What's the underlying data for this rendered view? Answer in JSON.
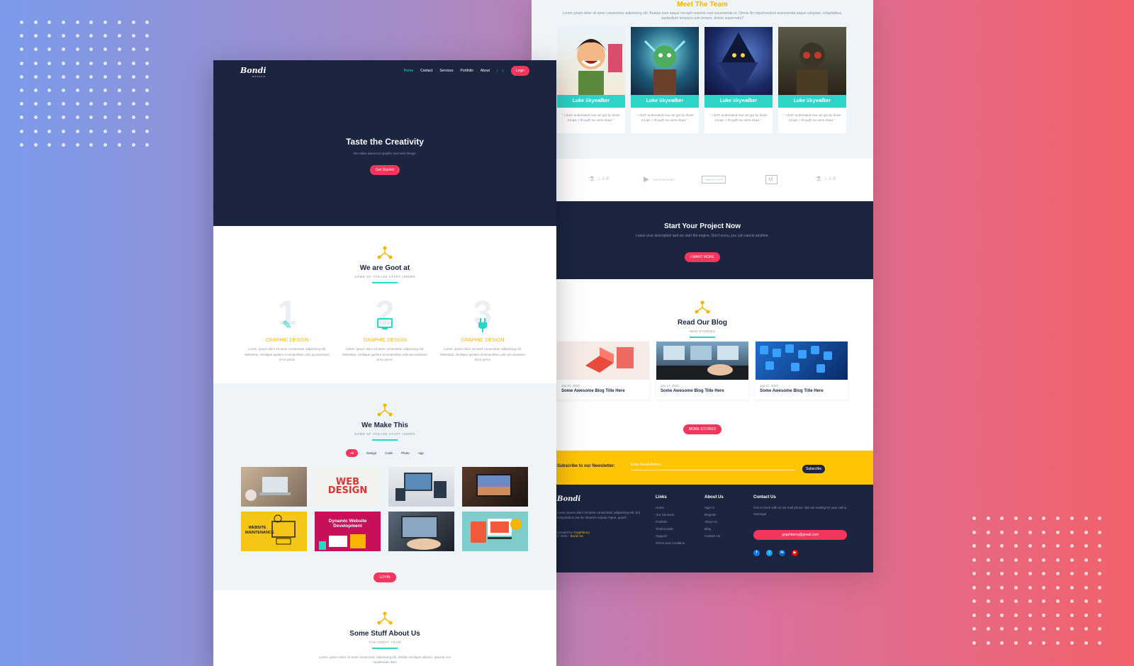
{
  "colors": {
    "navy": "#1b2540",
    "teal": "#2dd4c8",
    "red": "#f5365c",
    "yellow": "#ffc505",
    "gold": "#f7b500",
    "light": "#eef4f8"
  },
  "nav": {
    "logo": "Bondi",
    "logo_tag": "DESIGN",
    "items": [
      "Home",
      "Contact",
      "Services",
      "Portfolio",
      "About"
    ],
    "active": "Home",
    "login": "Login",
    "search_icon": "search-icon"
  },
  "hero": {
    "title": "Taste the Creativity",
    "subtitle": "We make awesome graphic and web design.",
    "cta": "Get Started"
  },
  "good": {
    "title": "We are Goot at",
    "subtitle": "SOME OF THEASE STUFF UNDER",
    "features": [
      {
        "num": "1",
        "icon": "pencil-icon",
        "title": "GRAPHIC DESIGN",
        "text": "Lorem, ipsum dolor sit amet consectetur adipisicing elit. Molestias, similique quidem et temporibus odio accusantium error porro!"
      },
      {
        "num": "2",
        "icon": "monitor-icon",
        "title": "GRAPHIC DESIGN",
        "text": "Lorem, ipsum dolor sit amet consectetur adipisicing elit. Molestias, similique quidem et temporibus odio accusantium error porro!"
      },
      {
        "num": "3",
        "icon": "plug-icon",
        "title": "GRAPHIC DESIGN",
        "text": "Lorem, ipsum dolor sit amet consectetur adipisicing elit. Molestias, similique quidem et temporibus odio accusantium error porro!"
      }
    ]
  },
  "make": {
    "title": "We Make This",
    "subtitle": "SOME OF THEASE STUFF UNDER",
    "filters": [
      "All",
      "Design",
      "Code",
      "Photo",
      "App"
    ],
    "active_filter": "All",
    "more": "LOVIN",
    "items": [
      "",
      "WEB DESIGN",
      "",
      "",
      "WEBSITE MAINTENANCE",
      "Dynamic Website Development",
      "",
      ""
    ]
  },
  "about": {
    "title": "Some Stuff About Us",
    "subtitle": "THE GREAT TEAM",
    "text": "Lorem, ipsum dolor sit amet consectetur adipisicing elit. Debitis similique adipisci, placeat non repellendus illum"
  },
  "team": {
    "title": "Meet The Team",
    "desc": "Lorem ipsum dolor sit amet consectetur adipisicing elit. Beatae eum eaque corrupti maxime cum assumenda ut. Omnis illo reprehenderit assumenda eaque voluptas, voluptatibus, laudantium tempora cum tempor, dolore aspernatur?",
    "members": [
      {
        "name": "Luke Skywalker",
        "quote": "\" I don't understand how we got by those troops. I thought we were dead. \""
      },
      {
        "name": "Luke Skywalker",
        "quote": "\" I don't understand how we got by those troops. I thought we were dead. \""
      },
      {
        "name": "Luke Skywalker",
        "quote": "\" I don't understand how we got by those troops. I thought we were dead. \""
      },
      {
        "name": "Luke Skywalker",
        "quote": "\" I don't understand how we got by those troops. I thought we were dead. \""
      }
    ]
  },
  "logos": [
    "M",
    "LAB",
    "GROOVE MUSIC",
    "SIMPLE STEP",
    "M",
    "LAB"
  ],
  "project": {
    "title": "Start Your Project Now",
    "text": "Leave your description and we start the engine. Don't worry, you can cancel anytime.",
    "cta": "I WANT MORE"
  },
  "blog": {
    "title": "Read Our Blog",
    "subtitle": "NEW STORIES",
    "more": "MORE STORIES",
    "posts": [
      {
        "date": "Jan 01, 2022",
        "title": "Some Awesome Blog Title Here"
      },
      {
        "date": "Jan 17, 2022",
        "title": "Some Awesome Blog Title Here"
      },
      {
        "date": "Jan 17, 2022",
        "title": "Some Awesome Blog Title Here"
      }
    ]
  },
  "newsletter": {
    "label": "Subscribe to our Newsletter:",
    "placeholder": "Enter Email Adress",
    "button": "Subscribe"
  },
  "footer": {
    "about_text": "Lorem ipsum dolor sit amet consectetur adipisicing elit. Est voluptatibus aut hic laborum soluta! Atque, quod?",
    "created": "Created by",
    "creator": "Graphberry",
    "copyright": "© 2023 -",
    "brand": "Bondi Inc",
    "links_title": "Links",
    "links": [
      "Home",
      "Our Services",
      "Portfolio",
      "Testimonials",
      "Support",
      "Terms and Condition"
    ],
    "about_title": "About Us",
    "about_links": [
      "Sign In",
      "Register",
      "About Us",
      "Blog",
      "Contact Us"
    ],
    "contact_title": "Contact Us",
    "contact_text": "Get in touch with us via mail phone. We are waiting for your call or message",
    "email": "graphberry@gmail.com",
    "social": [
      "facebook-icon",
      "twitter-icon",
      "linkedin-icon",
      "youtube-icon"
    ]
  }
}
